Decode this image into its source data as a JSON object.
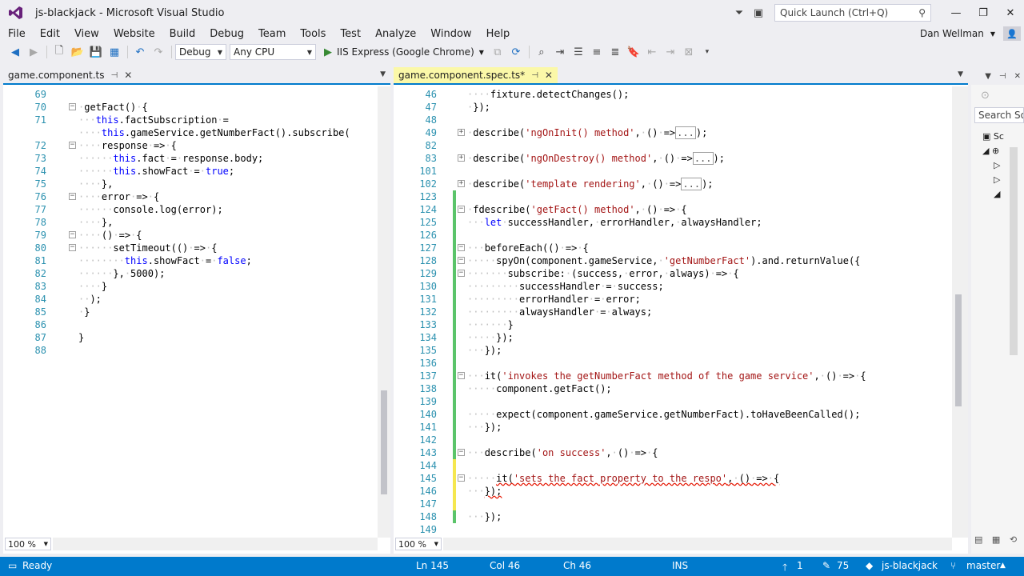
{
  "window": {
    "title": "js-blackjack - Microsoft Visual Studio",
    "quick_launch_placeholder": "Quick Launch (Ctrl+Q)"
  },
  "menu": [
    "File",
    "Edit",
    "View",
    "Website",
    "Build",
    "Debug",
    "Team",
    "Tools",
    "Test",
    "Analyze",
    "Window",
    "Help"
  ],
  "user": {
    "name": "Dan Wellman"
  },
  "toolbar": {
    "config": "Debug",
    "platform": "Any CPU",
    "run_target": "IIS Express (Google Chrome)"
  },
  "left_editor": {
    "tab": "game.component.ts",
    "zoom": "100 %",
    "lines": [
      {
        "n": "69",
        "code": ""
      },
      {
        "n": "70",
        "code": "getFact() {"
      },
      {
        "n": "71",
        "code": "this.factSubscription ="
      },
      {
        "n": "",
        "code": "this.gameService.getNumberFact().subscribe("
      },
      {
        "n": "72",
        "code": "response => {"
      },
      {
        "n": "73",
        "code": "this.fact = response.body;"
      },
      {
        "n": "74",
        "code": "this.showFact = true;"
      },
      {
        "n": "75",
        "code": "},"
      },
      {
        "n": "76",
        "code": "error => {"
      },
      {
        "n": "77",
        "code": "console.log(error);"
      },
      {
        "n": "78",
        "code": "},"
      },
      {
        "n": "79",
        "code": "() => {"
      },
      {
        "n": "80",
        "code": "setTimeout(() => {"
      },
      {
        "n": "81",
        "code": "this.showFact = false;"
      },
      {
        "n": "82",
        "code": "}, 5000);"
      },
      {
        "n": "83",
        "code": "}"
      },
      {
        "n": "84",
        "code": ");"
      },
      {
        "n": "85",
        "code": "}"
      },
      {
        "n": "86",
        "code": ""
      },
      {
        "n": "87",
        "code": "}"
      },
      {
        "n": "88",
        "code": ""
      }
    ]
  },
  "right_editor": {
    "tab": "game.component.spec.ts*",
    "zoom": "100 %",
    "lines": [
      {
        "n": "46",
        "code": "fixture.detectChanges();"
      },
      {
        "n": "47",
        "code": "});"
      },
      {
        "n": "48",
        "code": ""
      },
      {
        "n": "49",
        "code": "describe('ngOnInit() method', () =>"
      },
      {
        "n": "82",
        "code": ""
      },
      {
        "n": "83",
        "code": "describe('ngOnDestroy() method', () =>"
      },
      {
        "n": "101",
        "code": ""
      },
      {
        "n": "102",
        "code": "describe('template rendering', () =>"
      },
      {
        "n": "123",
        "code": ""
      },
      {
        "n": "124",
        "code": "fdescribe('getFact() method', () => {"
      },
      {
        "n": "125",
        "code": "let successHandler, errorHandler, alwaysHandler;"
      },
      {
        "n": "126",
        "code": ""
      },
      {
        "n": "127",
        "code": "beforeEach(() => {"
      },
      {
        "n": "128",
        "code": "spyOn(component.gameService, 'getNumberFact').and.returnValue({"
      },
      {
        "n": "129",
        "code": "subscribe: (success, error, always) => {"
      },
      {
        "n": "130",
        "code": "successHandler = success;"
      },
      {
        "n": "131",
        "code": "errorHandler = error;"
      },
      {
        "n": "132",
        "code": "alwaysHandler = always;"
      },
      {
        "n": "133",
        "code": "}"
      },
      {
        "n": "134",
        "code": "});"
      },
      {
        "n": "135",
        "code": "});"
      },
      {
        "n": "136",
        "code": ""
      },
      {
        "n": "137",
        "code": "it('invokes the getNumberFact method of the game service', () => {"
      },
      {
        "n": "138",
        "code": "component.getFact();"
      },
      {
        "n": "139",
        "code": ""
      },
      {
        "n": "140",
        "code": "expect(component.gameService.getNumberFact).toHaveBeenCalled();"
      },
      {
        "n": "141",
        "code": "});"
      },
      {
        "n": "142",
        "code": ""
      },
      {
        "n": "143",
        "code": "describe('on success', () => {"
      },
      {
        "n": "144",
        "code": ""
      },
      {
        "n": "145",
        "code": "it('sets the fact property to the respo', () => {"
      },
      {
        "n": "146",
        "code": "});"
      },
      {
        "n": "147",
        "code": ""
      },
      {
        "n": "148",
        "code": "});"
      },
      {
        "n": "149",
        "code": ""
      }
    ]
  },
  "solution_explorer": {
    "search": "Search Sol",
    "node": "Sc"
  },
  "status": {
    "ready": "Ready",
    "ln": "Ln 145",
    "col": "Col 46",
    "ch": "Ch 46",
    "mode": "INS",
    "up_count": "1",
    "edit_count": "75",
    "repo": "js-blackjack",
    "branch": "master"
  }
}
